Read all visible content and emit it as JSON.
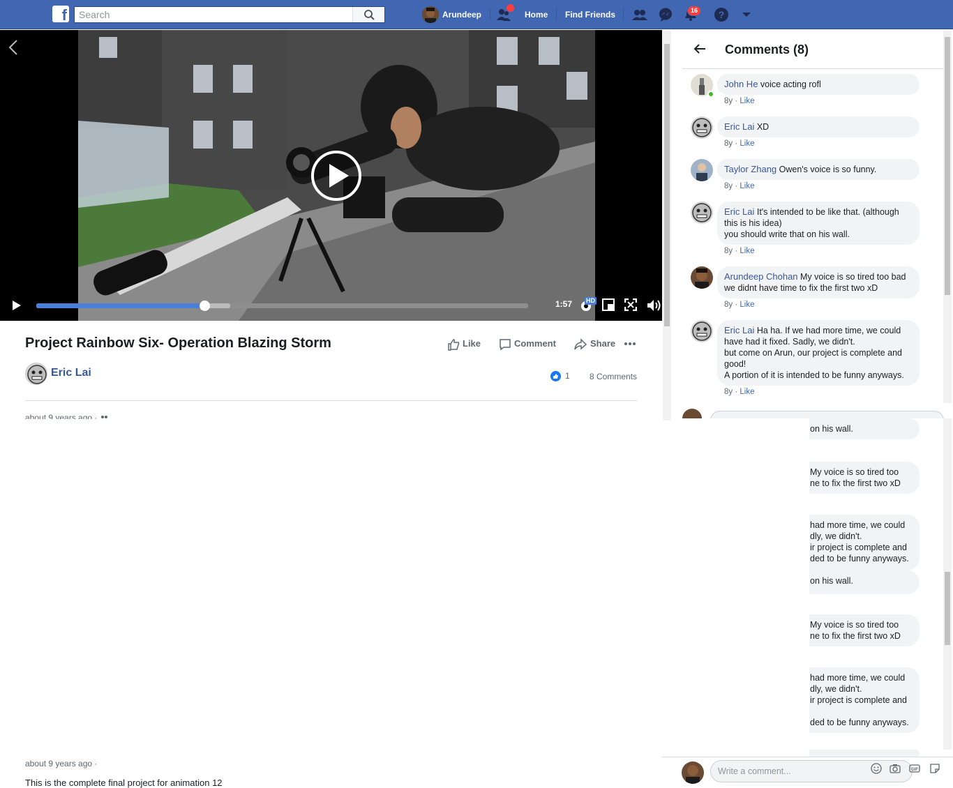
{
  "topbar": {
    "logo_letter": "f",
    "search_placeholder": "Search",
    "user_name": "Arundeep",
    "home": "Home",
    "find_friends": "Find Friends",
    "notification_count": "16",
    "colors": {
      "bar": "#4267b2",
      "badge": "#fa3e3e"
    }
  },
  "video": {
    "time": "1:57",
    "hd_badge": "HD",
    "progress_fraction": 0.342,
    "buffer_fraction": 0.394
  },
  "post": {
    "title": "Project Rainbow Six- Operation Blazing Storm",
    "actions": {
      "like": "Like",
      "comment": "Comment",
      "share": "Share"
    },
    "author": "Eric Lai",
    "like_count": "1",
    "comment_count": "8 Comments",
    "timestamp": "about 9 years ago ·",
    "description": "This is the complete final project for animation 12"
  },
  "comments": {
    "title": "Comments (8)",
    "like_label": "Like",
    "items": [
      {
        "author": "John He",
        "text": "voice acting rofl",
        "age": "8y ·"
      },
      {
        "author": "Eric Lai",
        "text": "XD",
        "age": "8y ·"
      },
      {
        "author": "Taylor Zhang",
        "text": "Owen's voice is so funny.",
        "age": "8y ·"
      },
      {
        "author": "Eric Lai",
        "text": "It's intended to be like that. (although this is his idea)",
        "text2": "you should write that on his wall.",
        "age": "8y ·"
      },
      {
        "author": "Arundeep Chohan",
        "text": "My voice is so tired too bad we didnt have time to fix the first two xD",
        "age": "8y ·"
      },
      {
        "author": "Eric Lai",
        "text": "Ha ha. If we had more time, we could have had it fixed. Sadly, we didn't.",
        "text2": "but come on Arun, our project is complete and good!",
        "text3": "A portion of it is intended to be funny anyways.",
        "age": "8y ·"
      }
    ],
    "write_placeholder": "Write a comment..."
  },
  "ghost": {
    "wall": "on his wall.",
    "voice_1": "My voice is so tired too",
    "voice_2": "ne to fix the first two xD",
    "had_1": "had more time, we could",
    "had_2": "dly, we didn't.",
    "had_3": "ir project is complete and",
    "had_4": "ded to be funny anyways."
  }
}
